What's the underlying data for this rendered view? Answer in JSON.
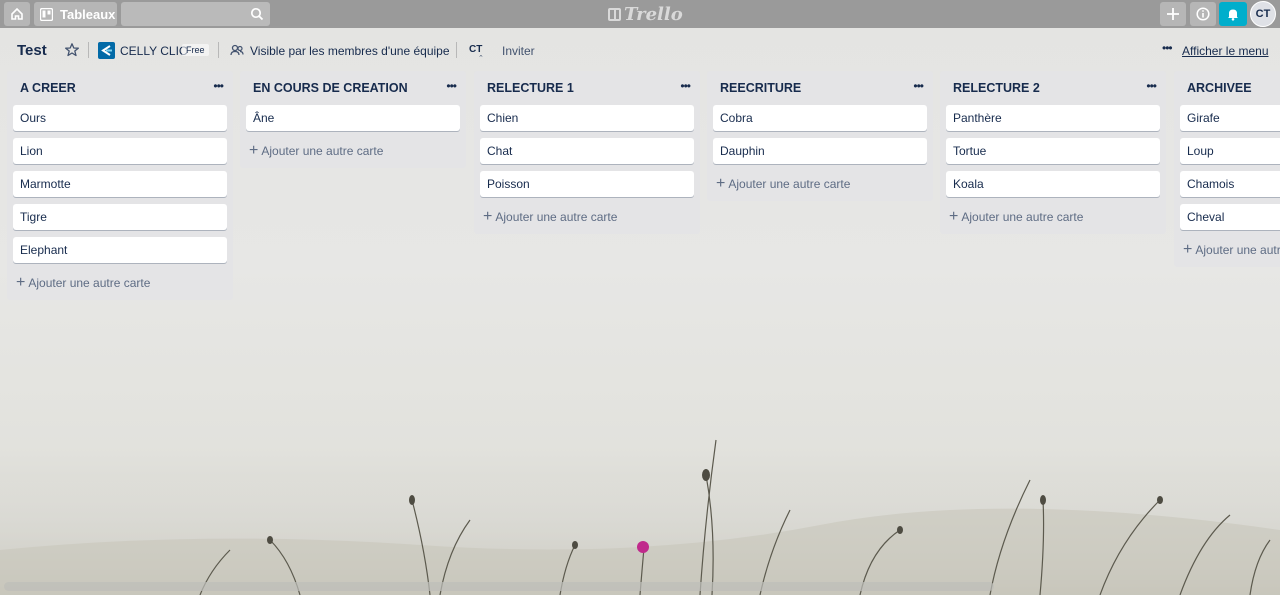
{
  "topbar": {
    "boards_label": "Tableaux",
    "logo_text": "Trello",
    "avatar_initials": "CT",
    "accent_bell": "#00aecc"
  },
  "board": {
    "title": "Test",
    "team_name": "CELLY CLIC",
    "team_badge": "Free",
    "visibility": "Visible par les membres d'une équipe",
    "member_initials": "CT",
    "invite_label": "Inviter",
    "menu_label": "Afficher le menu"
  },
  "lists": [
    {
      "title": "A CREER",
      "cards": [
        "Ours",
        "Lion",
        "Marmotte",
        "Tigre",
        "Elephant"
      ],
      "add_label": "Ajouter une autre carte"
    },
    {
      "title": "EN COURS DE CREATION",
      "cards": [
        "Âne"
      ],
      "add_label": "Ajouter une autre carte"
    },
    {
      "title": "RELECTURE 1",
      "cards": [
        "Chien",
        "Chat",
        "Poisson"
      ],
      "add_label": "Ajouter une autre carte"
    },
    {
      "title": "REECRITURE",
      "cards": [
        "Cobra",
        "Dauphin"
      ],
      "add_label": "Ajouter une autre carte"
    },
    {
      "title": "RELECTURE 2",
      "cards": [
        "Panthère",
        "Tortue",
        "Koala"
      ],
      "add_label": "Ajouter une autre carte"
    },
    {
      "title": "ARCHIVEE",
      "cards": [
        "Girafe",
        "Loup",
        "Chamois",
        "Cheval"
      ],
      "add_label": "Ajouter une autre carte"
    }
  ]
}
